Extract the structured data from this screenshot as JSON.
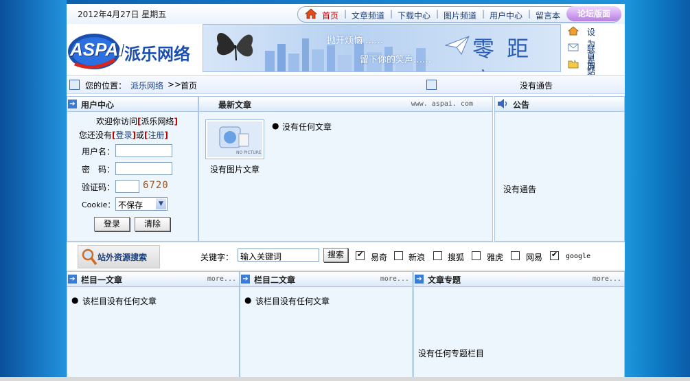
{
  "header": {
    "date": "2012年4月27日 星期五",
    "nav": [
      "首页",
      "文章频道",
      "下载中心",
      "图片频道",
      "用户中心",
      "留言本"
    ],
    "forum": "论坛版面",
    "logo_text": "ASPAI",
    "logo_cn": "派乐网络",
    "banner_line1": "抛开烦恼 ……",
    "banner_line2": "留下你的笑声……",
    "banner_title": "零 距 离",
    "quicklinks": [
      "设为首页",
      "联系站长",
      "加入收藏"
    ]
  },
  "location": {
    "label": "您的位置：",
    "site": "派乐网络",
    "sep": ">>",
    "current": "首页",
    "notice": "没有通告"
  },
  "user_center": {
    "title": "用户中心",
    "welcome_prefix": "欢迎你访问",
    "welcome_site": "派乐网络",
    "no_account": "您还没有",
    "login_link": "登录",
    "or": "或",
    "register_link": "注册",
    "username_label": "用户名：",
    "password_label": "密　码：",
    "captcha_label": "验证码：",
    "captcha_value": "6720",
    "cookie_label": "Cookie：",
    "cookie_option": "不保存",
    "login_btn": "登录",
    "clear_btn": "清除"
  },
  "latest": {
    "title": "最新文章",
    "site_url": "www. aspai. com",
    "no_picture_caption": "没有图片文章",
    "no_picture_badge": "NO PICTURE",
    "no_article": "没有任何文章"
  },
  "announce": {
    "title": "公告",
    "text": "没有通告"
  },
  "search": {
    "brand": "站外资源搜索",
    "keyword_label": "关键字：",
    "keyword_value": "输入关键词",
    "button": "搜索",
    "engines": [
      {
        "name": "易奇",
        "checked": true
      },
      {
        "name": "新浪",
        "checked": false
      },
      {
        "name": "搜狐",
        "checked": false
      },
      {
        "name": "雅虎",
        "checked": false
      },
      {
        "name": "网易",
        "checked": false
      },
      {
        "name": "google",
        "checked": true
      }
    ]
  },
  "columns": {
    "col1_title": "栏目一文章",
    "col1_more": "more...",
    "col1_empty": "该栏目没有任何文章",
    "col2_title": "栏目二文章",
    "col2_more": "more...",
    "col2_empty": "该栏目没有任何文章",
    "col3_title": "文章专题",
    "col3_more": "more...",
    "col3_empty": "没有任何专题栏目"
  },
  "colors": {
    "accent": "#1a3e7a",
    "red": "#c00000",
    "panel_bg": "#eef6fd"
  }
}
